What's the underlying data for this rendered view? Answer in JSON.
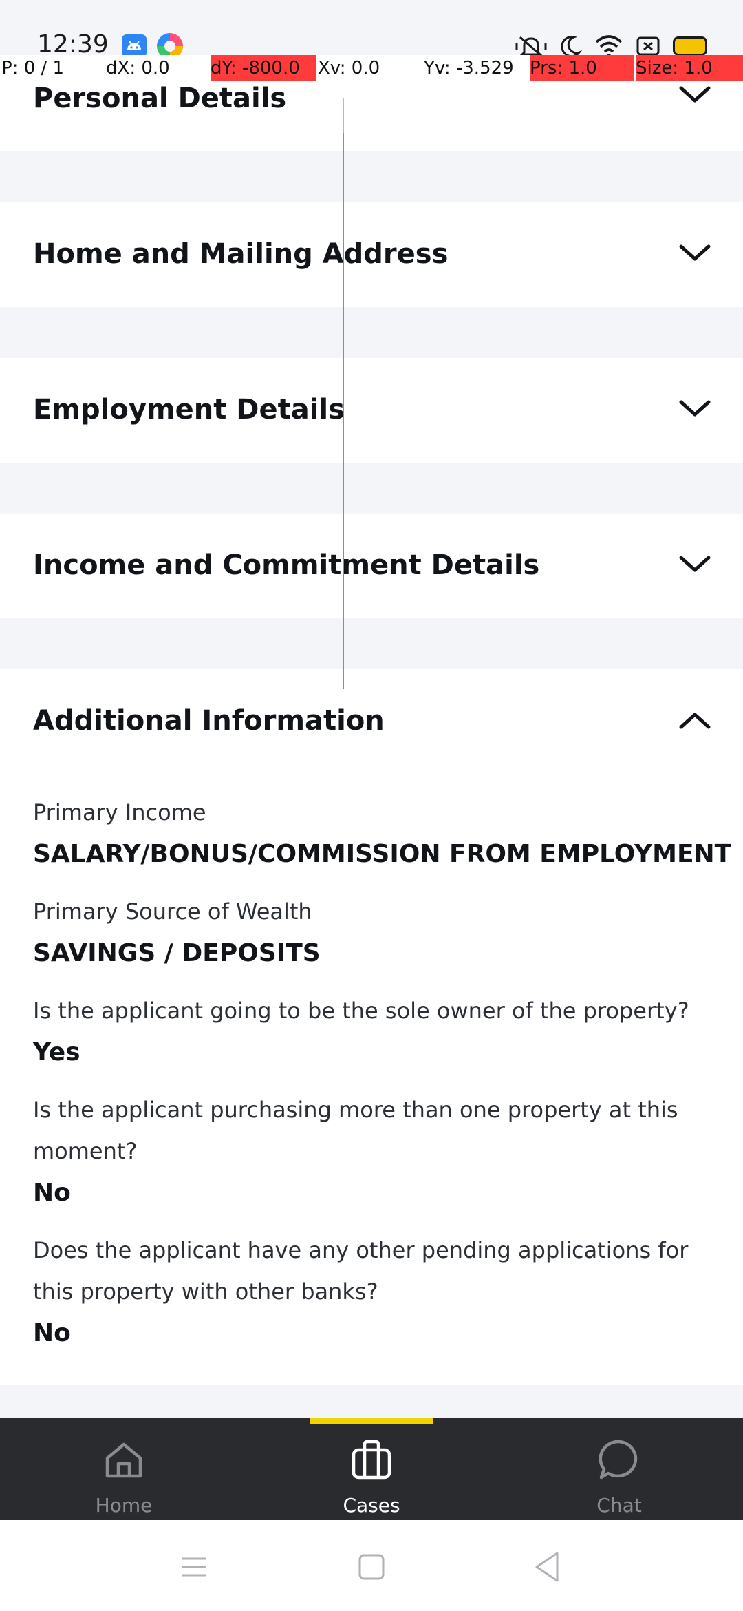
{
  "status_bar": {
    "time": "12:39"
  },
  "pointer_overlay": {
    "pointer": "P: 0 / 1",
    "dx": "dX: 0.0",
    "dy": "dY: -800.0",
    "xv": "Xv: 0.0",
    "yv": "Yv: -3.529",
    "prs": "Prs: 1.0",
    "size": "Size: 1.0"
  },
  "sections": [
    {
      "title": "Personal Details",
      "expanded": false
    },
    {
      "title": "Home and Mailing Address",
      "expanded": false
    },
    {
      "title": "Employment Details",
      "expanded": false
    },
    {
      "title": "Income and Commitment Details",
      "expanded": false
    },
    {
      "title": "Additional Information",
      "expanded": true
    }
  ],
  "additional_info": {
    "fields": [
      {
        "label": "Primary Income",
        "value": "SALARY/BONUS/COMMISSION FROM EMPLOYMENT"
      },
      {
        "label": "Primary Source of Wealth",
        "value": "SAVINGS / DEPOSITS"
      },
      {
        "label": "Is the applicant going to be the sole owner of the property?",
        "value": "Yes"
      },
      {
        "label": "Is the applicant purchasing more than one property at this moment?",
        "value": "No"
      },
      {
        "label": "Does the applicant have any other pending applications for this property with other banks?",
        "value": "No"
      }
    ]
  },
  "bottom_nav": {
    "items": [
      {
        "label": "Home",
        "icon": "home-icon",
        "active": false
      },
      {
        "label": "Cases",
        "icon": "briefcase-icon",
        "active": true
      },
      {
        "label": "Chat",
        "icon": "chat-bubble-icon",
        "active": false
      }
    ],
    "active_indicator_color": "#f2d400"
  },
  "colors": {
    "background": "#f4f5f9",
    "panel": "#ffffff",
    "nav_background": "#2a2b2f",
    "nav_active": "#ffffff",
    "nav_inactive": "#8a8b90",
    "overlay_highlight": "#ff3b3b"
  }
}
